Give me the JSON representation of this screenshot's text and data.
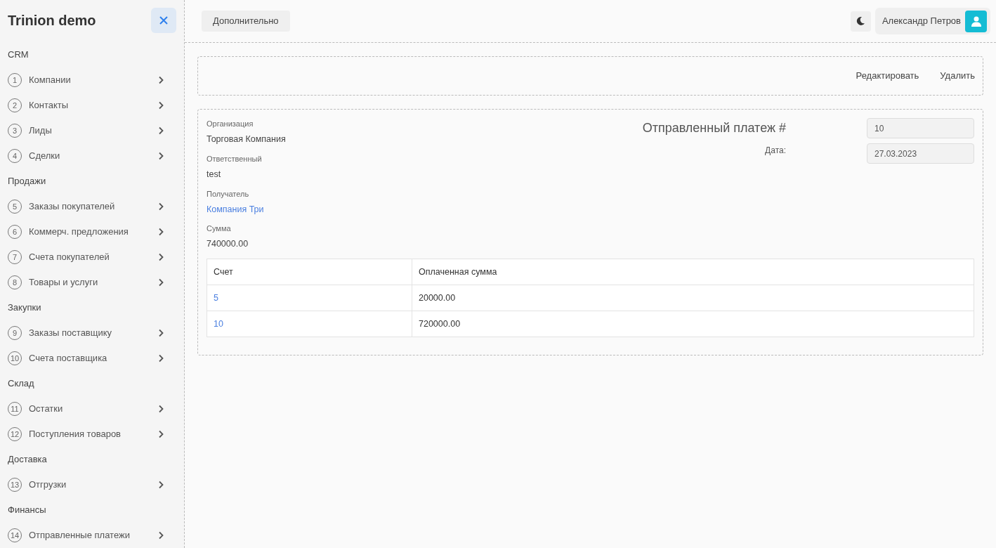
{
  "sidebar": {
    "title": "Trinion demo",
    "sections": [
      {
        "title": "CRM",
        "items": [
          {
            "number": "1",
            "label": "Компании"
          },
          {
            "number": "2",
            "label": "Контакты"
          },
          {
            "number": "3",
            "label": "Лиды"
          },
          {
            "number": "4",
            "label": "Сделки"
          }
        ]
      },
      {
        "title": "Продажи",
        "items": [
          {
            "number": "5",
            "label": "Заказы покупателей"
          },
          {
            "number": "6",
            "label": "Коммерч. предложения"
          },
          {
            "number": "7",
            "label": "Счета покупателей"
          },
          {
            "number": "8",
            "label": "Товары и услуги"
          }
        ]
      },
      {
        "title": "Закупки",
        "items": [
          {
            "number": "9",
            "label": "Заказы поставщику"
          },
          {
            "number": "10",
            "label": "Счета поставщика"
          }
        ]
      },
      {
        "title": "Склад",
        "items": [
          {
            "number": "11",
            "label": "Остатки"
          },
          {
            "number": "12",
            "label": "Поступления товаров"
          }
        ]
      },
      {
        "title": "Доставка",
        "items": [
          {
            "number": "13",
            "label": "Отгрузки"
          }
        ]
      },
      {
        "title": "Финансы",
        "items": [
          {
            "number": "14",
            "label": "Отправленные платежи"
          }
        ]
      }
    ]
  },
  "topbar": {
    "menu_button": "Дополнительно",
    "user_name": "Александр Петров"
  },
  "actions": [
    "Редактировать",
    "Удалить"
  ],
  "document": {
    "fields": [
      {
        "label": "Организация",
        "value": "Торговая Компания",
        "kind": "text"
      },
      {
        "label": "Ответственный",
        "value": "test",
        "kind": "text"
      },
      {
        "label": "Получатель",
        "value": "Компания Три",
        "kind": "link"
      },
      {
        "label": "Сумма",
        "value": "740000.00",
        "kind": "text"
      }
    ],
    "title": "Отправленный платеж #",
    "number": "10",
    "date_label": "Дата:",
    "date": "27.03.2023",
    "table": {
      "columns": [
        "Счет",
        "Оплаченная сумма"
      ],
      "rows": [
        [
          "5",
          "20000.00"
        ],
        [
          "10",
          "720000.00"
        ]
      ]
    }
  }
}
